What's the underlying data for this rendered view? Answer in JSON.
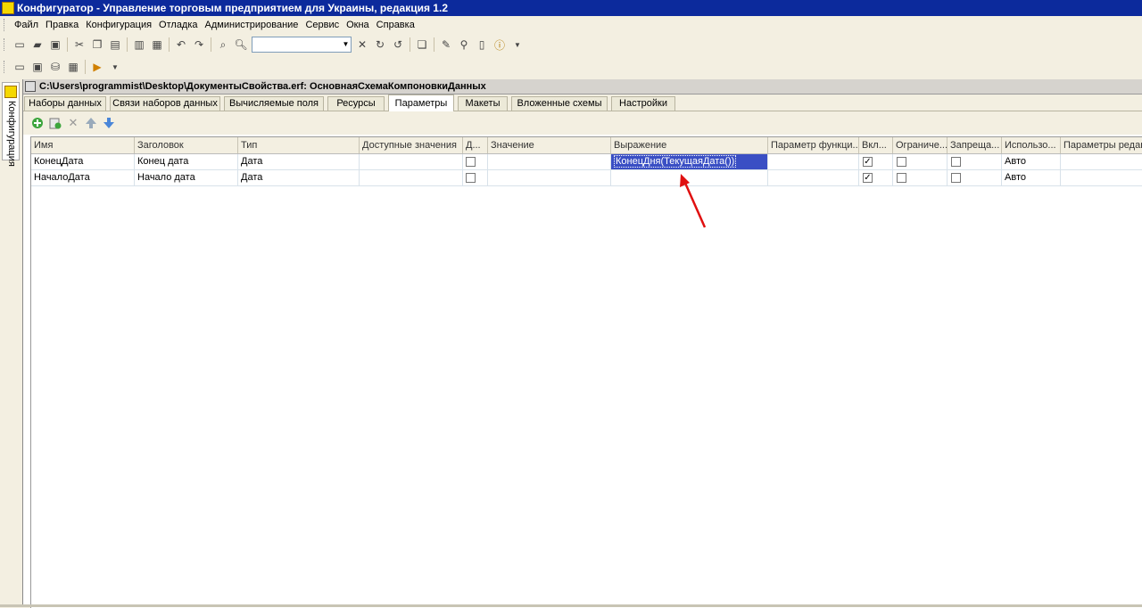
{
  "window_title": "Конфигуратор - Управление торговым предприятием для Украины, редакция 1.2",
  "menu": [
    "Файл",
    "Правка",
    "Конфигурация",
    "Отладка",
    "Администрирование",
    "Сервис",
    "Окна",
    "Справка"
  ],
  "side_panel_label": "Конфигурация",
  "document_title": "C:\\Users\\programmist\\Desktop\\ДокументыСвойства.erf: ОсновнаяСхемаКомпоновкиДанных",
  "tabs": [
    "Наборы данных",
    "Связи наборов данных",
    "Вычисляемые поля",
    "Ресурсы",
    "Параметры",
    "Макеты",
    "Вложенные схемы",
    "Настройки"
  ],
  "active_tab": "Параметры",
  "columns": [
    "Имя",
    "Заголовок",
    "Тип",
    "Доступные значения",
    "Д...",
    "Значение",
    "Выражение",
    "Параметр функци...",
    "Вкл...",
    "Ограниче...",
    "Запреща...",
    "Использо...",
    "Параметры редакт..."
  ],
  "rows": [
    {
      "name": "КонецДата",
      "title": "Конец дата",
      "type": "Дата",
      "expression": "КонецДня(ТекущаяДата())",
      "enabled": true,
      "use": "Авто"
    },
    {
      "name": "НачалоДата",
      "title": "Начало дата",
      "type": "Дата",
      "expression": "",
      "enabled": true,
      "use": "Авто"
    }
  ],
  "colors": {
    "titlebar": "#0c2a9c",
    "selection": "#3a4fc4",
    "arrow": "#e01010"
  }
}
